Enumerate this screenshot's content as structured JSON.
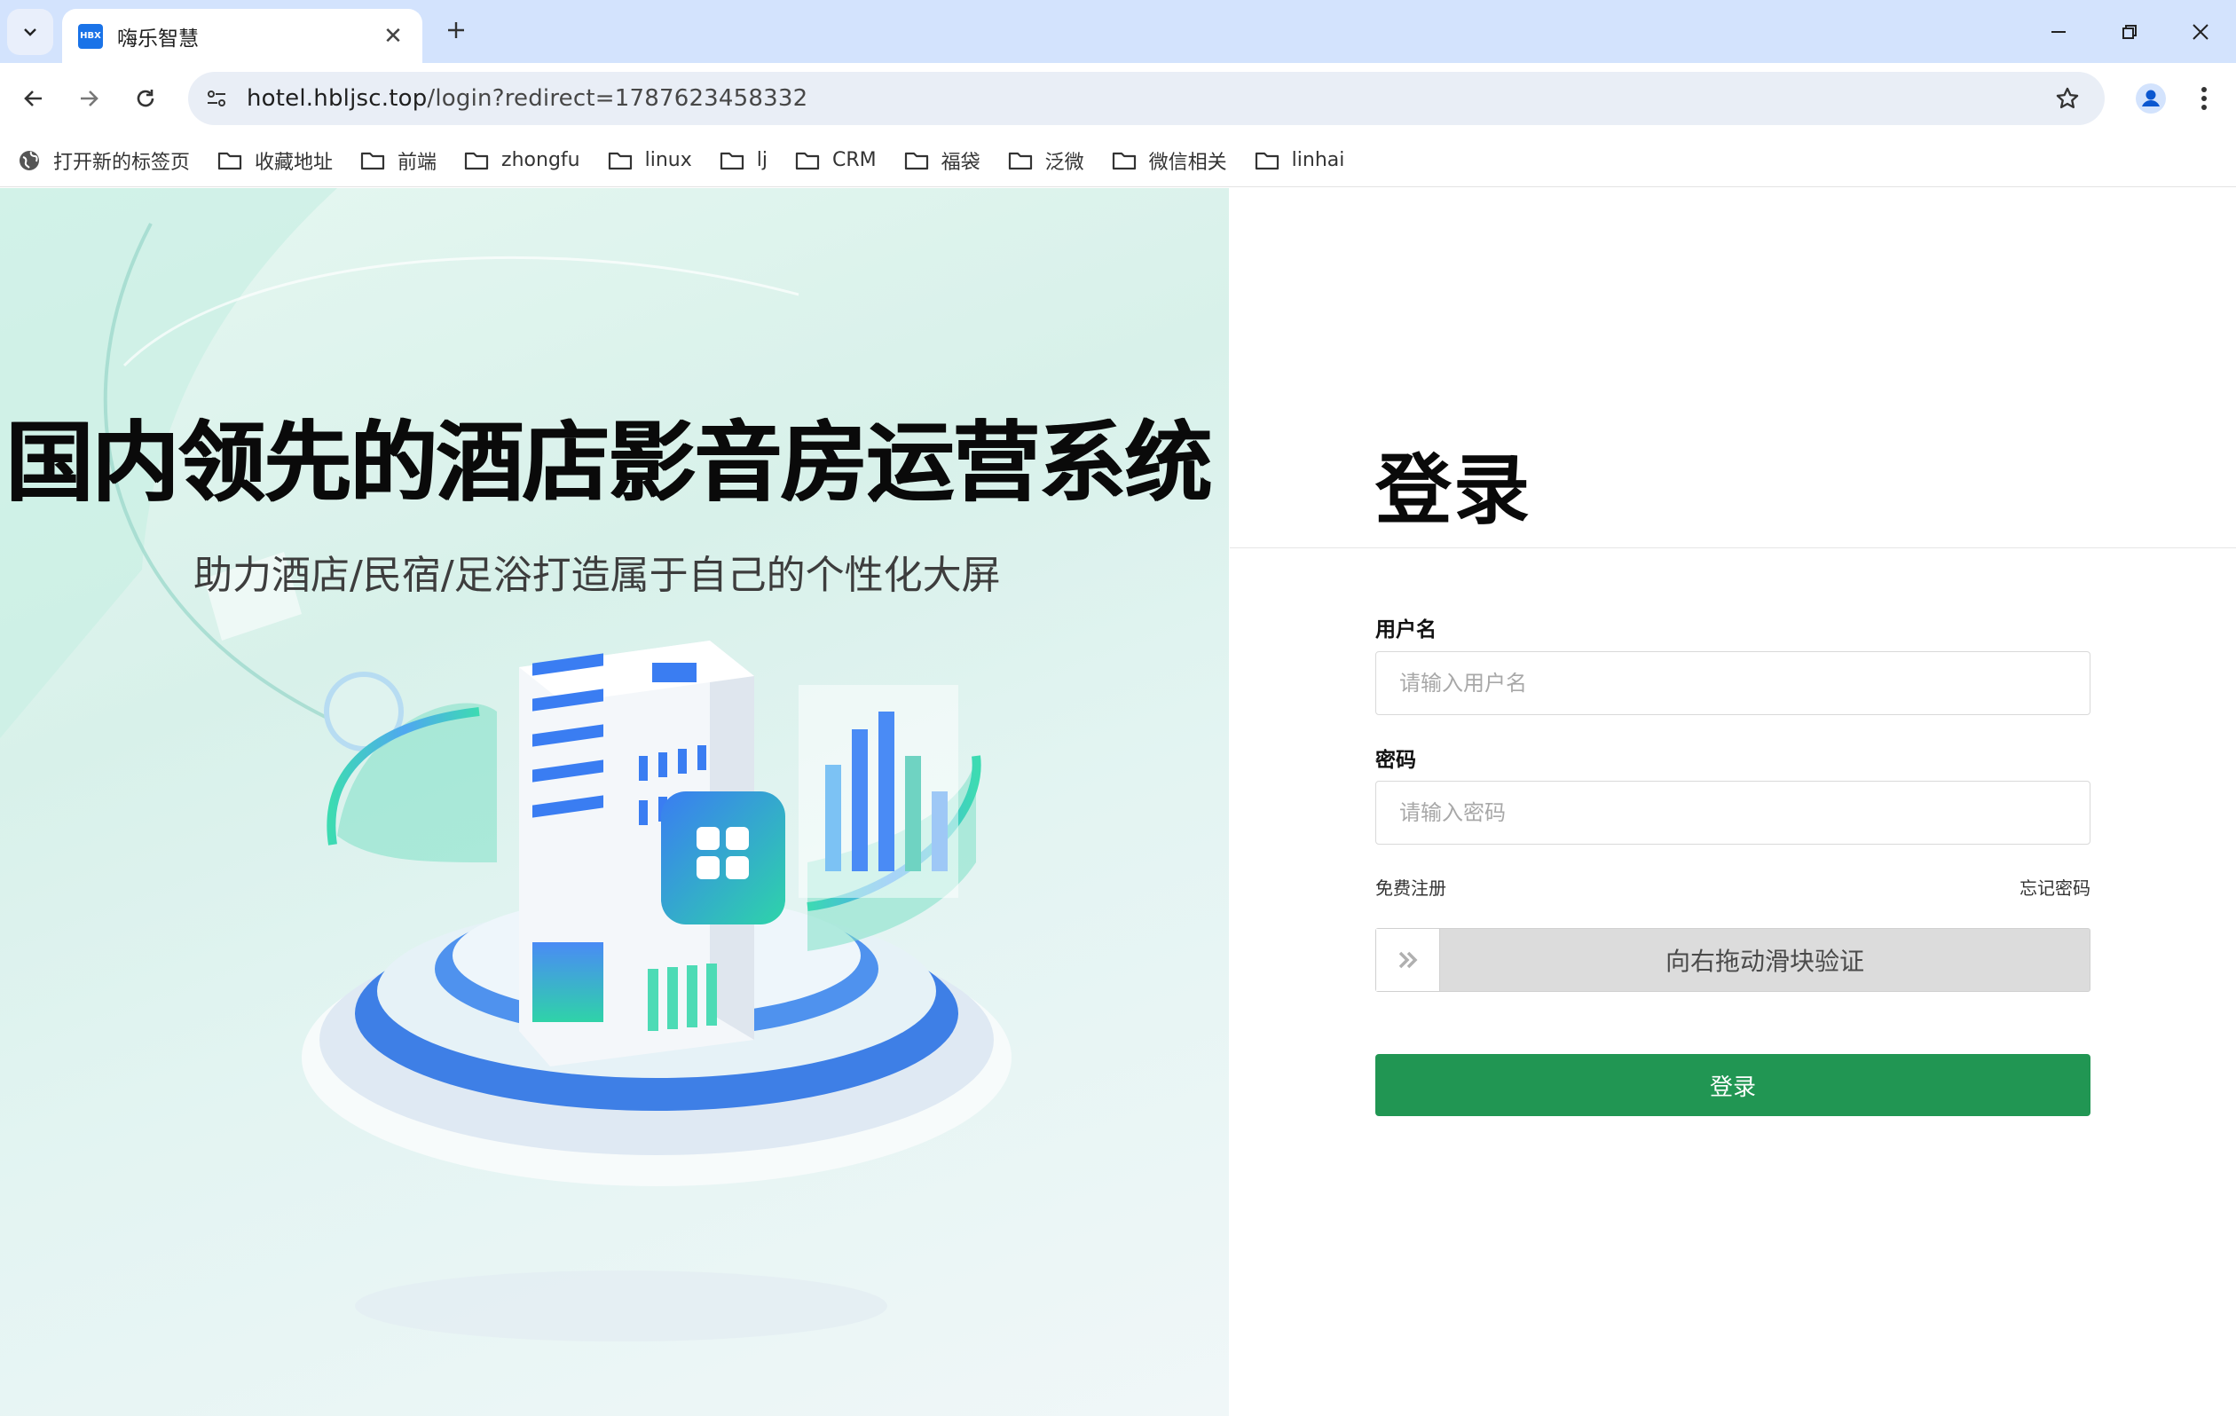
{
  "browser": {
    "tab_title": "嗨乐智慧",
    "favicon_text": "HBX",
    "url_host": "hotel.hbljsc.top",
    "url_path": "/login?redirect=1787623458332",
    "bookmarks": [
      "打开新的标签页",
      "收藏地址",
      "前端",
      "zhongfu",
      "linux",
      "lj",
      "CRM",
      "福袋",
      "泛微",
      "微信相关",
      "linhai"
    ]
  },
  "hero": {
    "title": "国内领先的酒店影音房运营系统",
    "subtitle": "助力酒店/民宿/足浴打造属于自己的个性化大屏"
  },
  "login": {
    "title": "登录",
    "username_label": "用户名",
    "username_placeholder": "请输入用户名",
    "password_label": "密码",
    "password_placeholder": "请输入密码",
    "register_link": "免费注册",
    "forgot_link": "忘记密码",
    "slider_text": "向右拖动滑块验证",
    "submit_label": "登录"
  },
  "colors": {
    "tabstrip": "#d3e3fd",
    "primary_button": "#219653",
    "hero_bg": "#d8f1ea"
  },
  "icons": [
    "chevron-down-icon",
    "close-icon",
    "plus-icon",
    "minimize-icon",
    "restore-icon",
    "back-icon",
    "forward-icon",
    "reload-icon",
    "site-info-icon",
    "star-icon",
    "profile-icon",
    "more-vert-icon",
    "globe-icon",
    "folder-icon",
    "double-chevron-right-icon"
  ]
}
